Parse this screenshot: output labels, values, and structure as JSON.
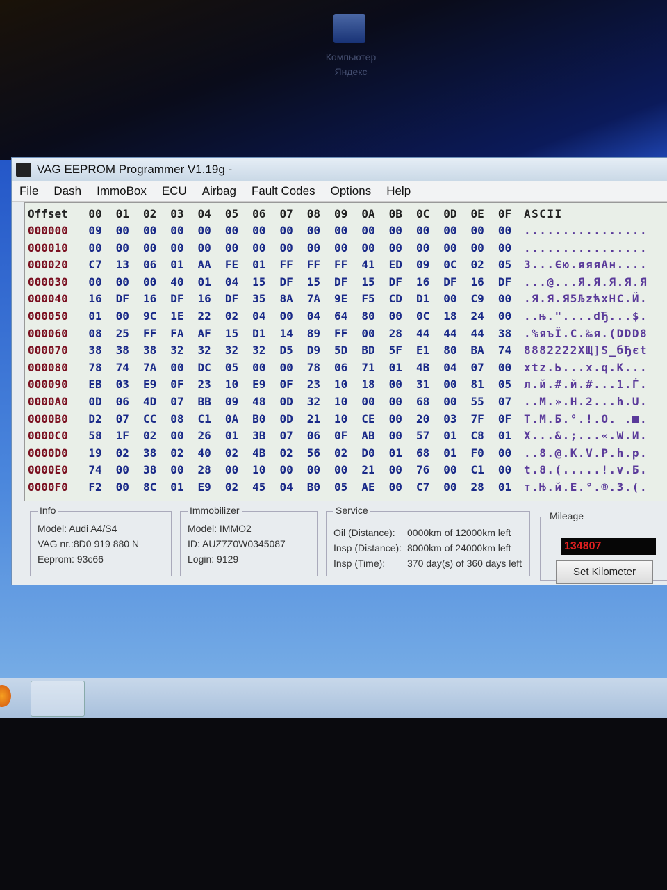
{
  "desktop": {
    "icon_label_1": "Компьютер",
    "icon_label_2": "Яндекс"
  },
  "window": {
    "title": "VAG EEPROM Programmer  V1.19g -"
  },
  "menu": [
    "File",
    "Dash",
    "ImmoBox",
    "ECU",
    "Airbag",
    "Fault Codes",
    "Options",
    "Help"
  ],
  "hex": {
    "header_offset": "Offset",
    "header_cols": [
      "00",
      "01",
      "02",
      "03",
      "04",
      "05",
      "06",
      "07",
      "08",
      "09",
      "0A",
      "0B",
      "0C",
      "0D",
      "0E",
      "0F"
    ],
    "header_ascii": "ASCII",
    "rows": [
      {
        "offset": "000000",
        "bytes": [
          "09",
          "00",
          "00",
          "00",
          "00",
          "00",
          "00",
          "00",
          "00",
          "00",
          "00",
          "00",
          "00",
          "00",
          "00",
          "00"
        ],
        "ascii": "................"
      },
      {
        "offset": "000010",
        "bytes": [
          "00",
          "00",
          "00",
          "00",
          "00",
          "00",
          "00",
          "00",
          "00",
          "00",
          "00",
          "00",
          "00",
          "00",
          "00",
          "00"
        ],
        "ascii": "................"
      },
      {
        "offset": "000020",
        "bytes": [
          "C7",
          "13",
          "06",
          "01",
          "AA",
          "FE",
          "01",
          "FF",
          "FF",
          "FF",
          "41",
          "ED",
          "09",
          "0C",
          "02",
          "05"
        ],
        "ascii": "З...Єю.яяяАн...."
      },
      {
        "offset": "000030",
        "bytes": [
          "00",
          "00",
          "00",
          "40",
          "01",
          "04",
          "15",
          "DF",
          "15",
          "DF",
          "15",
          "DF",
          "16",
          "DF",
          "16",
          "DF"
        ],
        "ascii": "...@...Я.Я.Я.Я.Я"
      },
      {
        "offset": "000040",
        "bytes": [
          "16",
          "DF",
          "16",
          "DF",
          "16",
          "DF",
          "35",
          "8A",
          "7A",
          "9E",
          "F5",
          "CD",
          "D1",
          "00",
          "C9",
          "00"
        ],
        "ascii": ".Я.Я.Я5ЉzћхНС.Й."
      },
      {
        "offset": "000050",
        "bytes": [
          "01",
          "00",
          "9C",
          "1E",
          "22",
          "02",
          "04",
          "00",
          "04",
          "64",
          "80",
          "00",
          "0C",
          "18",
          "24",
          "00"
        ],
        "ascii": "..њ.\"....dЂ...$."
      },
      {
        "offset": "000060",
        "bytes": [
          "08",
          "25",
          "FF",
          "FA",
          "AF",
          "15",
          "D1",
          "14",
          "89",
          "FF",
          "00",
          "28",
          "44",
          "44",
          "44",
          "38"
        ],
        "ascii": ".%яъЇ.С.‰я.(DDD8"
      },
      {
        "offset": "000070",
        "bytes": [
          "38",
          "38",
          "38",
          "32",
          "32",
          "32",
          "32",
          "D5",
          "D9",
          "5D",
          "BD",
          "5F",
          "E1",
          "80",
          "BA",
          "74"
        ],
        "ascii": "8882222ХЩ]Ѕ_бЂєt"
      },
      {
        "offset": "000080",
        "bytes": [
          "78",
          "74",
          "7A",
          "00",
          "DC",
          "05",
          "00",
          "00",
          "78",
          "06",
          "71",
          "01",
          "4B",
          "04",
          "07",
          "00"
        ],
        "ascii": "xtz.Ь...x.q.K..."
      },
      {
        "offset": "000090",
        "bytes": [
          "EB",
          "03",
          "E9",
          "0F",
          "23",
          "10",
          "E9",
          "0F",
          "23",
          "10",
          "18",
          "00",
          "31",
          "00",
          "81",
          "05"
        ],
        "ascii": "л.й.#.й.#...1.Ѓ."
      },
      {
        "offset": "0000A0",
        "bytes": [
          "0D",
          "06",
          "4D",
          "07",
          "BB",
          "09",
          "48",
          "0D",
          "32",
          "10",
          "00",
          "00",
          "68",
          "00",
          "55",
          "07"
        ],
        "ascii": "..M.».H.2...h.U."
      },
      {
        "offset": "0000B0",
        "bytes": [
          "D2",
          "07",
          "CC",
          "08",
          "C1",
          "0A",
          "B0",
          "0D",
          "21",
          "10",
          "CE",
          "00",
          "20",
          "03",
          "7F",
          "0F"
        ],
        "ascii": "Т.М.Б.°.!.О. .■."
      },
      {
        "offset": "0000C0",
        "bytes": [
          "58",
          "1F",
          "02",
          "00",
          "26",
          "01",
          "3B",
          "07",
          "06",
          "0F",
          "AB",
          "00",
          "57",
          "01",
          "C8",
          "01"
        ],
        "ascii": "X...&.;...«.W.И."
      },
      {
        "offset": "0000D0",
        "bytes": [
          "19",
          "02",
          "38",
          "02",
          "40",
          "02",
          "4B",
          "02",
          "56",
          "02",
          "D0",
          "01",
          "68",
          "01",
          "F0",
          "00"
        ],
        "ascii": "..8.@.K.V.Р.h.р."
      },
      {
        "offset": "0000E0",
        "bytes": [
          "74",
          "00",
          "38",
          "00",
          "28",
          "00",
          "10",
          "00",
          "00",
          "00",
          "21",
          "00",
          "76",
          "00",
          "C1",
          "00"
        ],
        "ascii": "t.8.(.....!.v.Б."
      },
      {
        "offset": "0000F0",
        "bytes": [
          "F2",
          "00",
          "8C",
          "01",
          "E9",
          "02",
          "45",
          "04",
          "B0",
          "05",
          "AE",
          "00",
          "C7",
          "00",
          "28",
          "01"
        ],
        "ascii": "т.Њ.й.E.°.®.З.(."
      }
    ]
  },
  "info": {
    "title": "Info",
    "model": "Model:  Audi A4/S4",
    "vag_nr": "VAG nr.:8D0 919 880 N",
    "eeprom": "Eeprom: 93c66"
  },
  "immobilizer": {
    "title": "Immobilizer",
    "model": "Model:  IMMO2",
    "id": "ID: AUZ7Z0W0345087",
    "login": "Login: 9129"
  },
  "service": {
    "title": "Service",
    "oil_label": "Oil (Distance):",
    "oil_value": "0000km of 12000km left",
    "insp_dist_label": "Insp (Distance):",
    "insp_dist_value": "8000km of 24000km left",
    "insp_time_label": "Insp (Time):",
    "insp_time_value": "370 day(s) of 360 days left"
  },
  "mileage": {
    "title": "Mileage",
    "value": "134807",
    "button": "Set Kilometer"
  },
  "colors": {
    "offset": "#7a1020",
    "hex": "#1a2a88",
    "ascii": "#5a3a9a",
    "mileage": "#e02020"
  }
}
